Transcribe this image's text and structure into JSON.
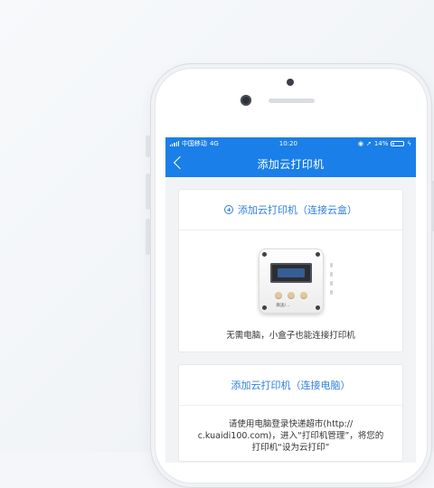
{
  "status_bar": {
    "carrier": "中国移动",
    "network": "4G",
    "time": "10:20",
    "battery": "14%"
  },
  "nav": {
    "title": "添加云打印机"
  },
  "card_box": {
    "title": "添加云打印机（连接云盒）",
    "device_label": "跌途/...",
    "description": "无需电脑，小盒子也能连接打印机"
  },
  "card_pc": {
    "title": "添加云打印机（连接电脑）",
    "line1": "请使用电脑登录快递超市(http://",
    "line2": "c.kuaidi100.com)，进入“打印机管理”，将您的",
    "line3": "打印机“设为云打印”"
  },
  "colors": {
    "accent": "#1a7fe8",
    "link": "#2f7fe0"
  }
}
